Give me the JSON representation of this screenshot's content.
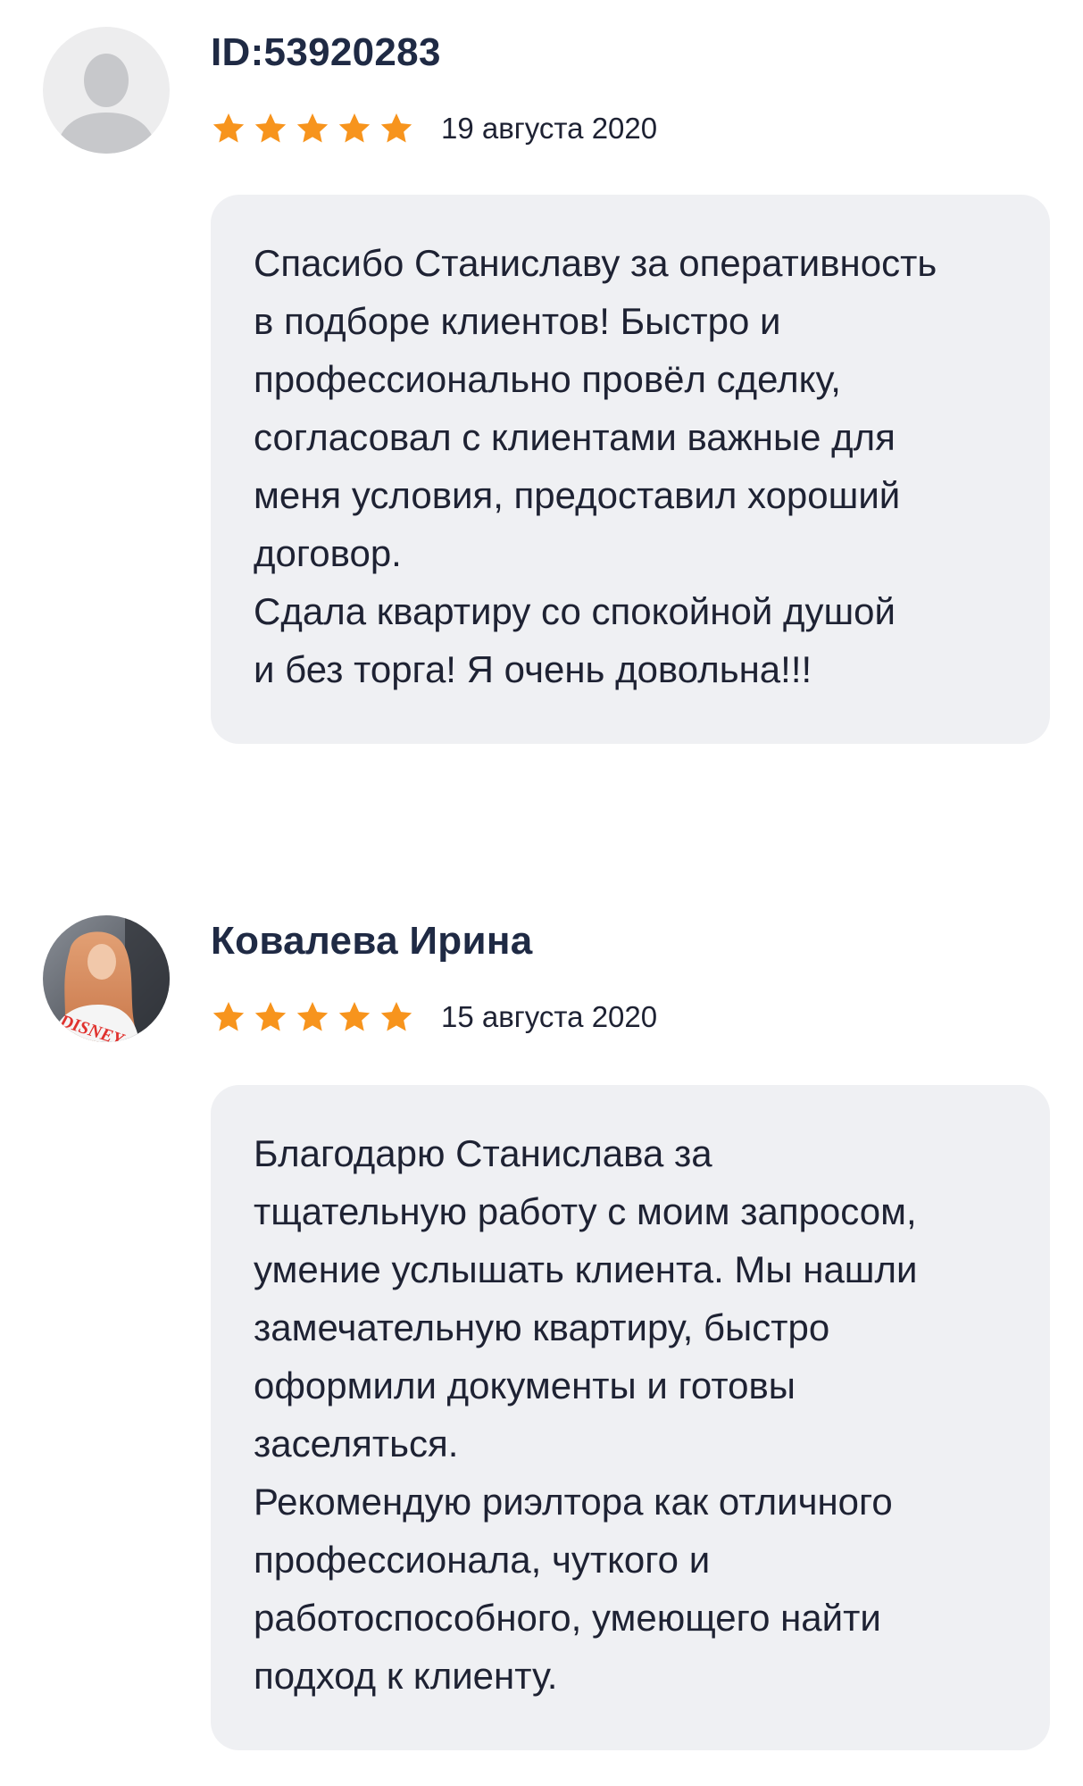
{
  "reviews": [
    {
      "author": "ID:53920283",
      "avatar_icon": "default-user-silhouette-icon",
      "rating": 5,
      "rating_max": 5,
      "date": "19 августа 2020",
      "text": "Спасибо Станиславу за оперативность\nв подборе клиентов! Быстро и\nпрофессионально провёл сделку,\nсогласовал с клиентами важные для\nменя условия, предоставил хороший\nдоговор.\nСдала квартиру со спокойной душой\nи без торга! Я очень довольна!!!"
    },
    {
      "author": "Ковалева Ирина",
      "avatar_icon": "user-photo-avatar",
      "rating": 5,
      "rating_max": 5,
      "date": "15 августа 2020",
      "text": "Благодарю Станислава за\nтщательную работу с моим запросом,\nумение услышать клиента. Мы нашли\nзамечательную квартиру, быстро\nоформили документы и готовы\nзаселяться.\nРекомендую риэлтора как отличного\nпрофессионала, чуткого и\nработоспособного, умеющего найти\nподход к клиенту."
    }
  ],
  "colors": {
    "star": "#f7941d",
    "bubble_background": "#eff0f3",
    "author_name": "#1f2a44",
    "body_text": "#1e2233"
  }
}
